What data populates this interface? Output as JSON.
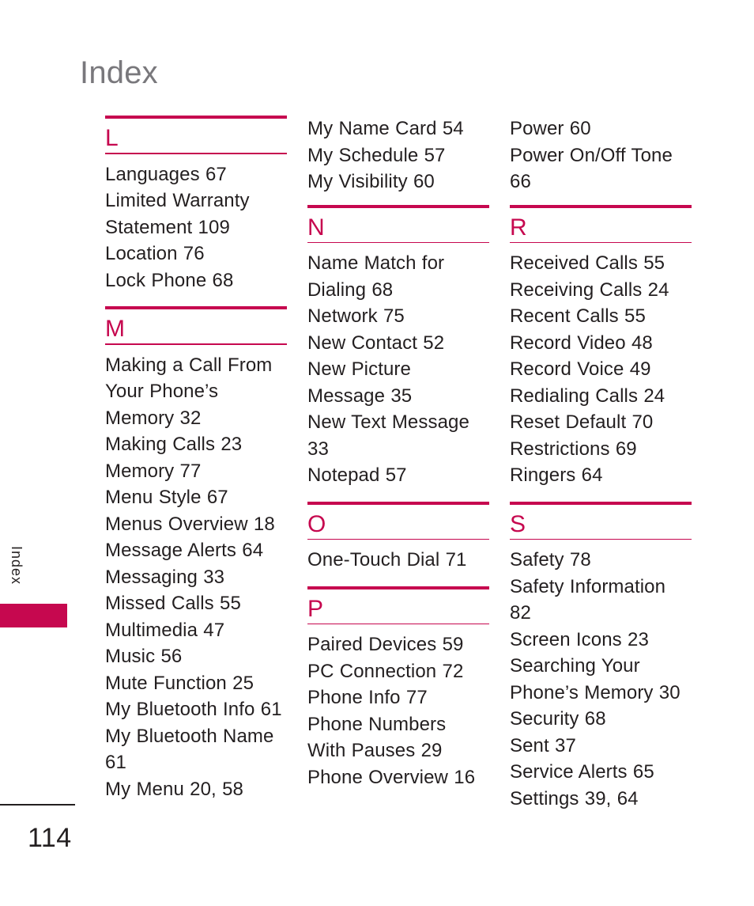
{
  "page": {
    "title": "Index",
    "side_tab_label": "Index",
    "page_number": "114",
    "accent_color": "#c6084f",
    "title_color": "#79787c",
    "text_color": "#231f20"
  },
  "columns": [
    {
      "id": "column-1",
      "orphan_entries": [],
      "sections": [
        {
          "letter": "L",
          "entries": [
            "Languages 67",
            "Limited Warranty Statement 109",
            "Location 76",
            "Lock Phone 68"
          ]
        },
        {
          "letter": "M",
          "entries": [
            "Making a Call From Your Phone’s Memory 32",
            "Making Calls 23",
            "Memory 77",
            "Menu Style 67",
            "Menus Overview 18",
            "Message Alerts 64",
            "Messaging 33",
            "Missed Calls 55",
            "Multimedia 47",
            "Music 56",
            "Mute Function 25",
            "My Bluetooth Info 61",
            "My Bluetooth Name 61",
            "My Menu 20, 58"
          ]
        }
      ]
    },
    {
      "id": "column-2",
      "orphan_entries": [
        "My Name Card 54",
        "My Schedule 57",
        "My Visibility 60"
      ],
      "sections": [
        {
          "letter": "N",
          "entries": [
            "Name Match for Dialing 68",
            "Network 75",
            "New Contact 52",
            "New Picture Message 35",
            "New Text Message 33",
            "Notepad 57"
          ]
        },
        {
          "letter": "O",
          "entries": [
            "One-Touch Dial 71"
          ]
        },
        {
          "letter": "P",
          "entries": [
            "Paired Devices 59",
            "PC Connection 72",
            "Phone Info 77",
            "Phone Numbers With Pauses 29",
            "Phone Overview 16"
          ]
        }
      ]
    },
    {
      "id": "column-3",
      "orphan_entries": [
        "Power 60",
        "Power On/Off Tone 66"
      ],
      "sections": [
        {
          "letter": "R",
          "entries": [
            "Received Calls 55",
            "Receiving Calls 24",
            "Recent Calls 55",
            "Record Video 48",
            "Record Voice 49",
            "Redialing Calls 24",
            "Reset Default 70",
            "Restrictions 69",
            "Ringers 64"
          ]
        },
        {
          "letter": "S",
          "entries": [
            "Safety 78",
            "Safety Information 82",
            "Screen Icons 23",
            "Searching Your Phone’s Memory 30",
            "Security 68",
            "Sent 37",
            "Service Alerts 65",
            "Settings 39, 64"
          ]
        }
      ]
    }
  ]
}
